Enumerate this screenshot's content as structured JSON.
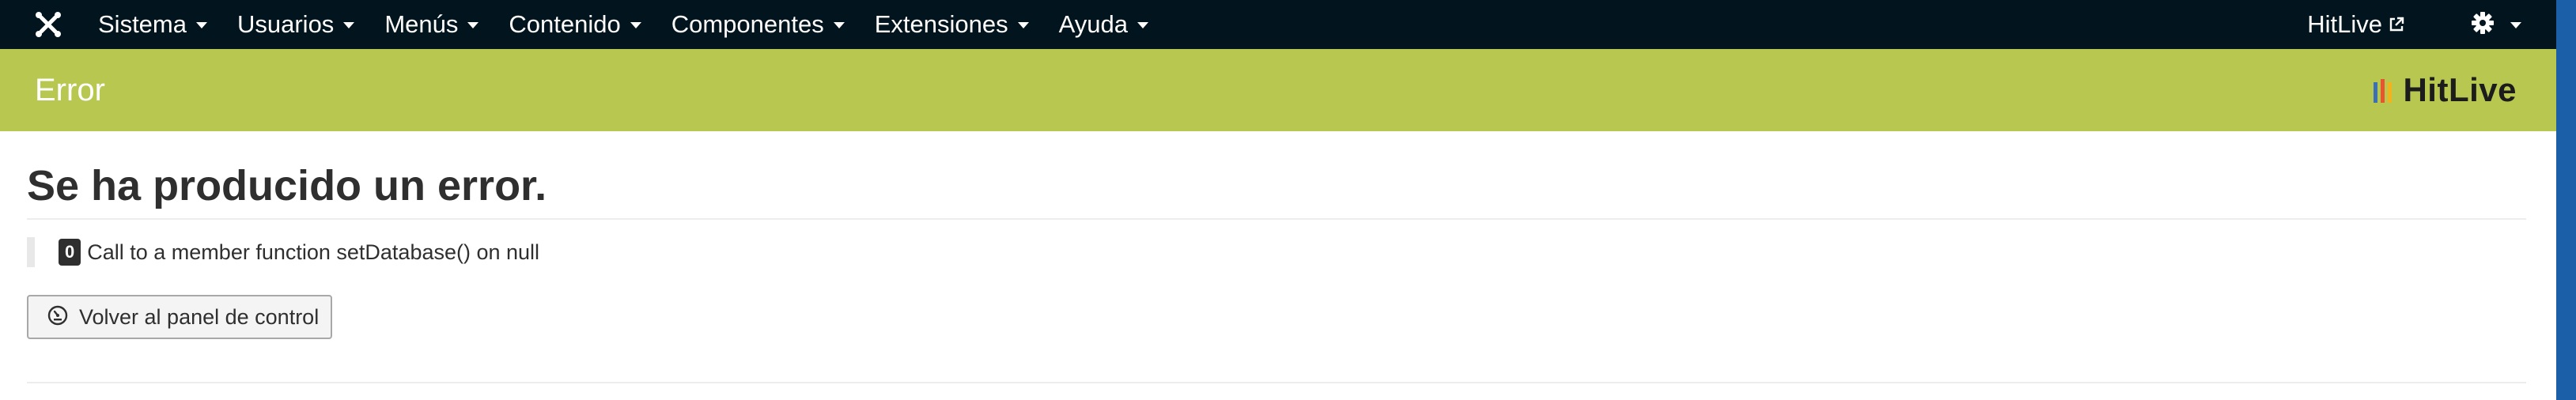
{
  "navbar": {
    "menu": [
      {
        "label": "Sistema"
      },
      {
        "label": "Usuarios"
      },
      {
        "label": "Menús"
      },
      {
        "label": "Contenido"
      },
      {
        "label": "Componentes"
      },
      {
        "label": "Extensiones"
      },
      {
        "label": "Ayuda"
      }
    ],
    "site_link": "HitLive",
    "logo_icon": "joomla-icon",
    "settings_icon": "gear-icon"
  },
  "subheader": {
    "title": "Error",
    "brand": "HitLive"
  },
  "content": {
    "title": "Se ha producido un error.",
    "error_code": "0",
    "error_message": "Call to a member function setDatabase() on null",
    "back_button": "Volver al panel de control"
  },
  "colors": {
    "navbar_bg": "#02151f",
    "header_bg": "#b8c74f",
    "brand_bar_1": "#3d6fb5",
    "brand_bar_2": "#e8542e",
    "brand_bar_3": "#f3b31c",
    "side_strip": "#1a5fa8"
  }
}
